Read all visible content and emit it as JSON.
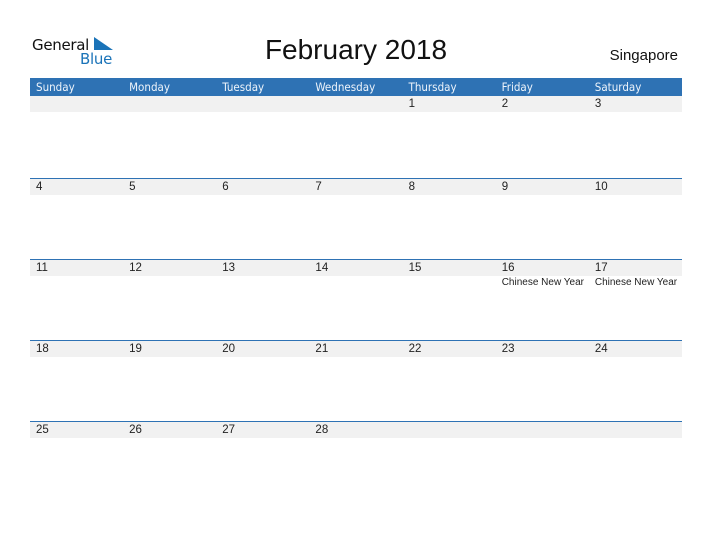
{
  "logo": {
    "line1": "General",
    "line2": "Blue"
  },
  "title": "February 2018",
  "country": "Singapore",
  "colors": {
    "accent": "#2e72b4",
    "date_strip": "#f1f1f1",
    "logo_blue": "#1a73b8"
  },
  "weekdays": [
    "Sunday",
    "Monday",
    "Tuesday",
    "Wednesday",
    "Thursday",
    "Friday",
    "Saturday"
  ],
  "weeks": [
    [
      {
        "day": ""
      },
      {
        "day": ""
      },
      {
        "day": ""
      },
      {
        "day": ""
      },
      {
        "day": "1"
      },
      {
        "day": "2"
      },
      {
        "day": "3"
      }
    ],
    [
      {
        "day": "4"
      },
      {
        "day": "5"
      },
      {
        "day": "6"
      },
      {
        "day": "7"
      },
      {
        "day": "8"
      },
      {
        "day": "9"
      },
      {
        "day": "10"
      }
    ],
    [
      {
        "day": "11"
      },
      {
        "day": "12"
      },
      {
        "day": "13"
      },
      {
        "day": "14"
      },
      {
        "day": "15"
      },
      {
        "day": "16",
        "event": "Chinese New Year"
      },
      {
        "day": "17",
        "event": "Chinese New Year"
      }
    ],
    [
      {
        "day": "18"
      },
      {
        "day": "19"
      },
      {
        "day": "20"
      },
      {
        "day": "21"
      },
      {
        "day": "22"
      },
      {
        "day": "23"
      },
      {
        "day": "24"
      }
    ],
    [
      {
        "day": "25"
      },
      {
        "day": "26"
      },
      {
        "day": "27"
      },
      {
        "day": "28"
      },
      {
        "day": ""
      },
      {
        "day": ""
      },
      {
        "day": ""
      }
    ]
  ]
}
